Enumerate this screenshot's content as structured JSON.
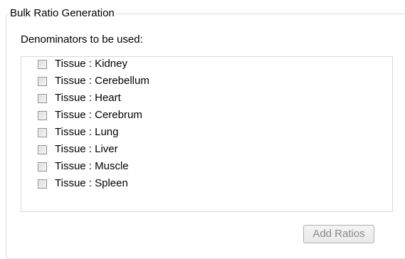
{
  "groupbox": {
    "title": "Bulk Ratio Generation"
  },
  "denominators": {
    "label": "Denominators to be used:",
    "items": [
      {
        "label": "Tissue : Kidney",
        "checked": false
      },
      {
        "label": "Tissue : Cerebellum",
        "checked": false
      },
      {
        "label": "Tissue : Heart",
        "checked": false
      },
      {
        "label": "Tissue : Cerebrum",
        "checked": false
      },
      {
        "label": "Tissue : Lung",
        "checked": false
      },
      {
        "label": "Tissue : Liver",
        "checked": false
      },
      {
        "label": "Tissue : Muscle",
        "checked": false
      },
      {
        "label": "Tissue : Spleen",
        "checked": false
      }
    ]
  },
  "actions": {
    "add_ratios_label": "Add Ratios",
    "add_ratios_enabled": false
  }
}
